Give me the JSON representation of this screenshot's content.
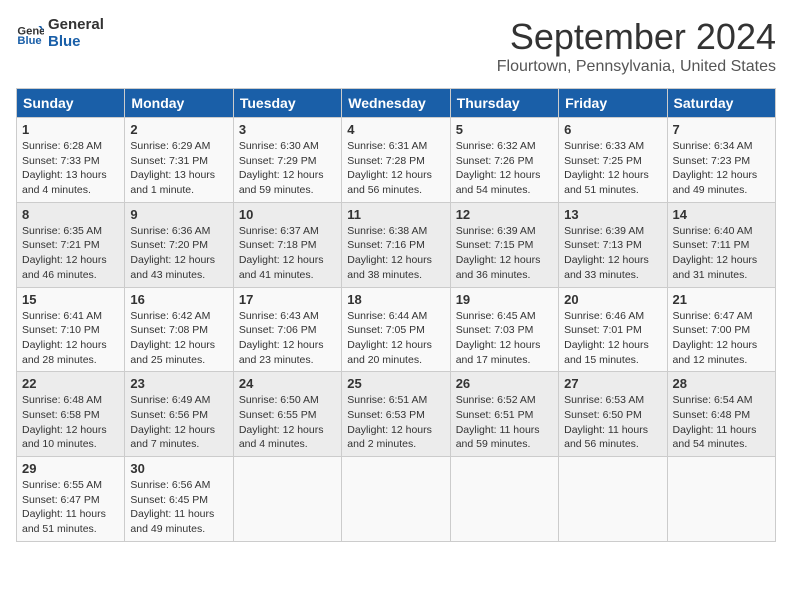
{
  "logo": {
    "text_general": "General",
    "text_blue": "Blue"
  },
  "title": "September 2024",
  "subtitle": "Flourtown, Pennsylvania, United States",
  "headers": [
    "Sunday",
    "Monday",
    "Tuesday",
    "Wednesday",
    "Thursday",
    "Friday",
    "Saturday"
  ],
  "weeks": [
    [
      {
        "day": "1",
        "sunrise": "6:28 AM",
        "sunset": "7:33 PM",
        "daylight": "13 hours and 4 minutes"
      },
      {
        "day": "2",
        "sunrise": "6:29 AM",
        "sunset": "7:31 PM",
        "daylight": "13 hours and 1 minute"
      },
      {
        "day": "3",
        "sunrise": "6:30 AM",
        "sunset": "7:29 PM",
        "daylight": "12 hours and 59 minutes"
      },
      {
        "day": "4",
        "sunrise": "6:31 AM",
        "sunset": "7:28 PM",
        "daylight": "12 hours and 56 minutes"
      },
      {
        "day": "5",
        "sunrise": "6:32 AM",
        "sunset": "7:26 PM",
        "daylight": "12 hours and 54 minutes"
      },
      {
        "day": "6",
        "sunrise": "6:33 AM",
        "sunset": "7:25 PM",
        "daylight": "12 hours and 51 minutes"
      },
      {
        "day": "7",
        "sunrise": "6:34 AM",
        "sunset": "7:23 PM",
        "daylight": "12 hours and 49 minutes"
      }
    ],
    [
      {
        "day": "8",
        "sunrise": "6:35 AM",
        "sunset": "7:21 PM",
        "daylight": "12 hours and 46 minutes"
      },
      {
        "day": "9",
        "sunrise": "6:36 AM",
        "sunset": "7:20 PM",
        "daylight": "12 hours and 43 minutes"
      },
      {
        "day": "10",
        "sunrise": "6:37 AM",
        "sunset": "7:18 PM",
        "daylight": "12 hours and 41 minutes"
      },
      {
        "day": "11",
        "sunrise": "6:38 AM",
        "sunset": "7:16 PM",
        "daylight": "12 hours and 38 minutes"
      },
      {
        "day": "12",
        "sunrise": "6:39 AM",
        "sunset": "7:15 PM",
        "daylight": "12 hours and 36 minutes"
      },
      {
        "day": "13",
        "sunrise": "6:39 AM",
        "sunset": "7:13 PM",
        "daylight": "12 hours and 33 minutes"
      },
      {
        "day": "14",
        "sunrise": "6:40 AM",
        "sunset": "7:11 PM",
        "daylight": "12 hours and 31 minutes"
      }
    ],
    [
      {
        "day": "15",
        "sunrise": "6:41 AM",
        "sunset": "7:10 PM",
        "daylight": "12 hours and 28 minutes"
      },
      {
        "day": "16",
        "sunrise": "6:42 AM",
        "sunset": "7:08 PM",
        "daylight": "12 hours and 25 minutes"
      },
      {
        "day": "17",
        "sunrise": "6:43 AM",
        "sunset": "7:06 PM",
        "daylight": "12 hours and 23 minutes"
      },
      {
        "day": "18",
        "sunrise": "6:44 AM",
        "sunset": "7:05 PM",
        "daylight": "12 hours and 20 minutes"
      },
      {
        "day": "19",
        "sunrise": "6:45 AM",
        "sunset": "7:03 PM",
        "daylight": "12 hours and 17 minutes"
      },
      {
        "day": "20",
        "sunrise": "6:46 AM",
        "sunset": "7:01 PM",
        "daylight": "12 hours and 15 minutes"
      },
      {
        "day": "21",
        "sunrise": "6:47 AM",
        "sunset": "7:00 PM",
        "daylight": "12 hours and 12 minutes"
      }
    ],
    [
      {
        "day": "22",
        "sunrise": "6:48 AM",
        "sunset": "6:58 PM",
        "daylight": "12 hours and 10 minutes"
      },
      {
        "day": "23",
        "sunrise": "6:49 AM",
        "sunset": "6:56 PM",
        "daylight": "12 hours and 7 minutes"
      },
      {
        "day": "24",
        "sunrise": "6:50 AM",
        "sunset": "6:55 PM",
        "daylight": "12 hours and 4 minutes"
      },
      {
        "day": "25",
        "sunrise": "6:51 AM",
        "sunset": "6:53 PM",
        "daylight": "12 hours and 2 minutes"
      },
      {
        "day": "26",
        "sunrise": "6:52 AM",
        "sunset": "6:51 PM",
        "daylight": "11 hours and 59 minutes"
      },
      {
        "day": "27",
        "sunrise": "6:53 AM",
        "sunset": "6:50 PM",
        "daylight": "11 hours and 56 minutes"
      },
      {
        "day": "28",
        "sunrise": "6:54 AM",
        "sunset": "6:48 PM",
        "daylight": "11 hours and 54 minutes"
      }
    ],
    [
      {
        "day": "29",
        "sunrise": "6:55 AM",
        "sunset": "6:47 PM",
        "daylight": "11 hours and 51 minutes"
      },
      {
        "day": "30",
        "sunrise": "6:56 AM",
        "sunset": "6:45 PM",
        "daylight": "11 hours and 49 minutes"
      },
      null,
      null,
      null,
      null,
      null
    ]
  ]
}
